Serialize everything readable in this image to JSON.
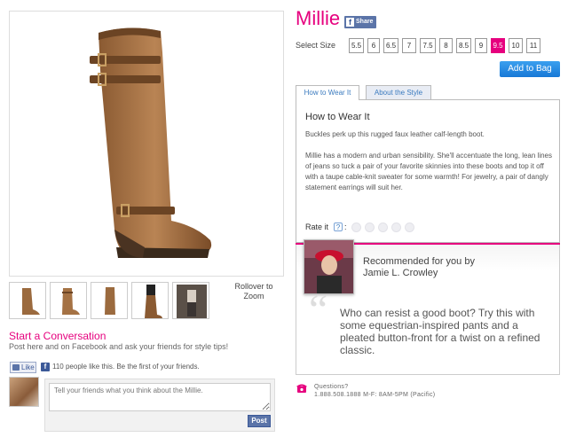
{
  "product": {
    "name": "Millie",
    "share_label": "Share",
    "rollover": "Rollover to Zoom"
  },
  "thumbnails": [
    "boot-side-view",
    "boot-angle-view",
    "boot-front-view",
    "boot-modeled-view",
    "outfit-view"
  ],
  "sizes": {
    "label": "Select Size",
    "options": [
      "5.5",
      "6",
      "6.5",
      "7",
      "7.5",
      "8",
      "8.5",
      "9",
      "9.5",
      "10",
      "11"
    ],
    "selected": "9.5"
  },
  "add_to_bag": "Add to Bag",
  "tabs": [
    "How to Wear It",
    "About the Style"
  ],
  "panel": {
    "title": "How to Wear It",
    "p1": "Buckles perk up this rugged faux leather calf-length boot.",
    "p2": "Millie has a modern and urban sensibility. She'll accentuate the long, lean lines of jeans so tuck a pair of your favorite skinnies into these boots and top it off with a taupe cable-knit sweater for some warmth! For jewelry, a pair of dangly statement earrings will suit her.",
    "rate_label": "Rate it",
    "rate_help": "?",
    "rating": 0
  },
  "recommendation": {
    "title": "Recommended for you by",
    "name": "Jamie L. Crowley",
    "quote_mark": "“",
    "quote": "Who can resist a good boot? Try this with some equestrian-inspired pants and a pleated button-front for a twist on a refined classic."
  },
  "conversation": {
    "title": "Start a Conversation",
    "subtitle": "Post here and on Facebook and ask your friends for style tips!",
    "like_label": "Like",
    "fb_glyph": "f",
    "like_text": "110 people like this. Be the first of your friends.",
    "placeholder": "Tell your friends what you think about the Millie.",
    "post_label": "Post"
  },
  "contact": {
    "line1": "Questions?",
    "line2": "1.888.508.1888 M-F: 8AM-5PM (Pacific)"
  },
  "colors": {
    "accent": "#e6007e",
    "facebook": "#3b5998",
    "button_blue": "#1878d6"
  }
}
